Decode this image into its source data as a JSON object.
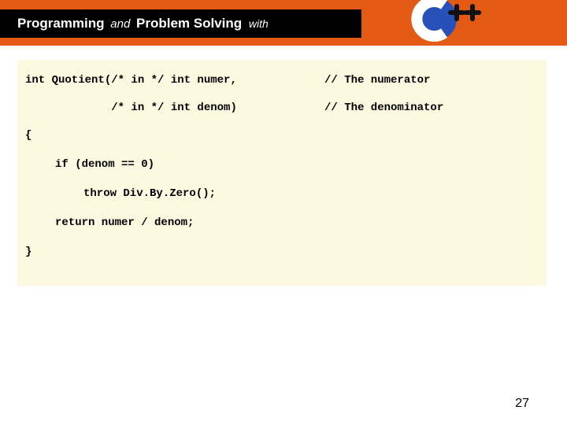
{
  "header": {
    "word1": "Programming",
    "and": "and",
    "word2": "Problem Solving",
    "with": "with"
  },
  "code": {
    "sig1_left": "int Quotient(/* in */ int numer,",
    "sig1_right": "// The numerator",
    "sig2_left": "             /* in */ int denom)",
    "sig2_right": "// The denominator",
    "l3": "{",
    "l4": "if (denom == 0)",
    "l5": "throw Div.By.Zero();",
    "l6": "return numer / denom;",
    "l7": "}"
  },
  "page_number": "27"
}
